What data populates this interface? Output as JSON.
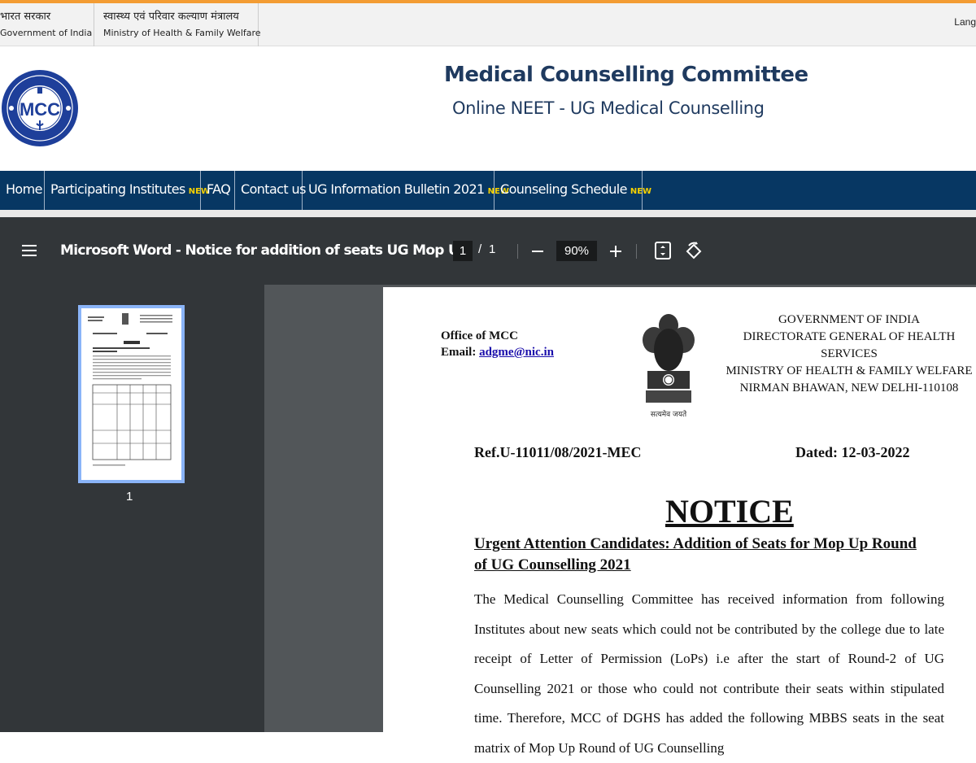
{
  "gov_bar": {
    "india_hindi": "भारत सरकार",
    "india_english": "Government of India",
    "ministry_hindi": "स्वास्थ्य एवं परिवार कल्याण मंत्रालय",
    "ministry_english": "Ministry of Health & Family Welfare",
    "language_label": "Lang"
  },
  "brand": {
    "logo_text": "MCC",
    "title": "Medical Counselling Committee",
    "subtitle": "Online NEET - UG Medical Counselling"
  },
  "nav": {
    "items": [
      {
        "label": "Home"
      },
      {
        "label": "Participating Institutes",
        "badge": "NEW"
      },
      {
        "label": "FAQ"
      },
      {
        "label": "Contact us"
      },
      {
        "label": "UG Information Bulletin 2021",
        "badge": "NEW"
      },
      {
        "label": "Counseling Schedule",
        "badge": "NEW"
      }
    ]
  },
  "viewer": {
    "doc_title": "Microsoft Word - Notice for addition of seats UG Mop Up",
    "current_page": "1",
    "page_sep": "/",
    "total_pages": "1",
    "zoom": "90%",
    "thumbnail_label": "1"
  },
  "document": {
    "office": "Office of MCC",
    "email_label": "Email:",
    "email": "adgme@nic.in",
    "emblem_caption": "सत्यमेव जयते",
    "gov_lines": [
      "GOVERNMENT OF INDIA",
      "DIRECTORATE GENERAL OF HEALTH SERVICES",
      "MINISTRY OF HEALTH & FAMILY WELFARE",
      "NIRMAN BHAWAN, NEW DELHI-110108"
    ],
    "ref": "Ref.U-11011/08/2021-MEC",
    "dated": "Dated: 12-03-2022",
    "notice_title": "NOTICE",
    "urgent_heading": "Urgent Attention Candidates: Addition of Seats for Mop Up Round of UG Counselling 2021",
    "body": "The Medical Counselling Committee has received information from following Institutes about new seats which could not be contributed by the college due to late receipt of Letter of Permission (LoPs) i.e after the start of Round-2 of UG Counselling 2021 or those who could not contribute their seats within stipulated time. Therefore, MCC of DGHS has added the following MBBS seats in the seat matrix of Mop Up Round of UG Counselling"
  },
  "colors": {
    "accent_orange": "#f39c33",
    "nav_blue": "#073763",
    "title_blue": "#1f3a5f",
    "viewer_dark": "#323639",
    "viewer_gray": "#525659",
    "new_badge": "#f6d000"
  }
}
